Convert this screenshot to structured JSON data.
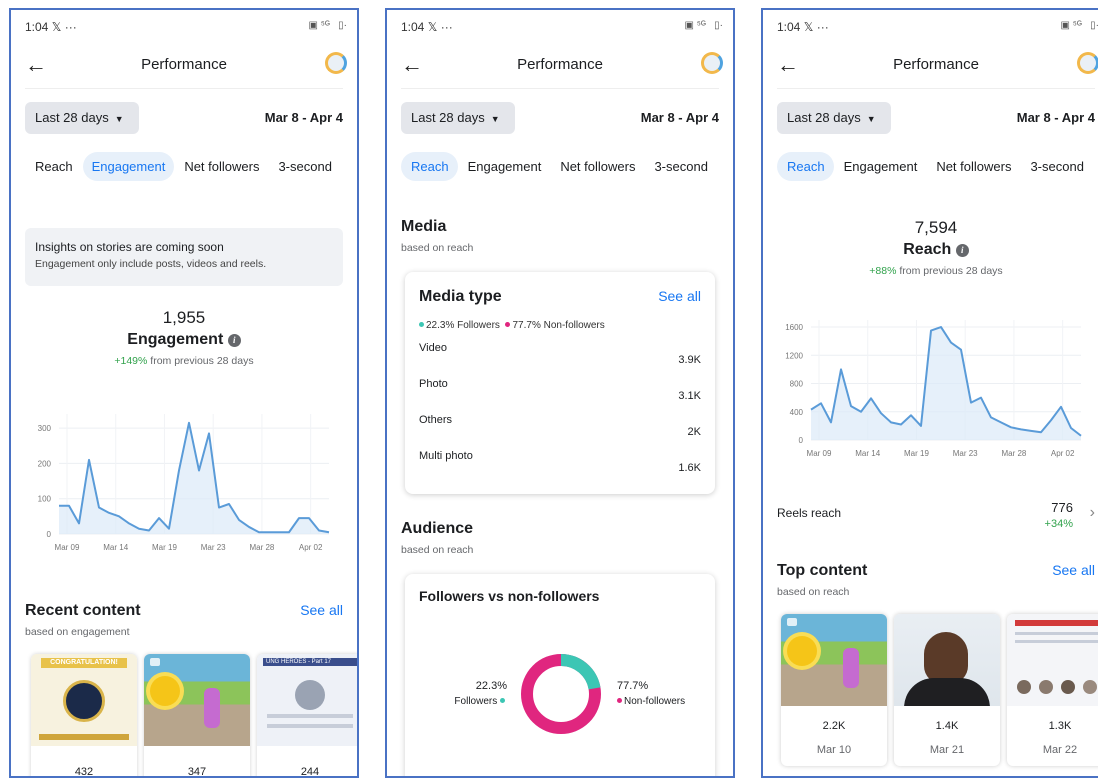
{
  "status": {
    "time": "1:04",
    "x": "𝕏",
    "dots": "···"
  },
  "header": {
    "title": "Performance"
  },
  "filter": {
    "range": "Last 28 days",
    "dates": "Mar 8 - Apr 4"
  },
  "tabs": [
    "Reach",
    "Engagement",
    "Net followers",
    "3-second"
  ],
  "screen1": {
    "notice_title": "Insights on stories are coming soon",
    "notice_text": "Engagement only include posts, videos and reels.",
    "total": "1,955",
    "metric": "Engagement",
    "change_pct": "+149%",
    "change_text": "from previous 28 days",
    "recent_title": "Recent content",
    "recent_sub": "based on engagement",
    "see_all": "See all",
    "thumb1_caption": "CONGRATULATION!",
    "thumb3_caption": "UNG HEROES - Part 17",
    "thumbs": [
      "432",
      "347",
      "244"
    ]
  },
  "screen2": {
    "media_title": "Media",
    "media_sub": "based on reach",
    "card_title": "Media type",
    "see_all": "See all",
    "legend_followers": "22.3% Followers",
    "legend_nonfollowers": "77.7% Non-followers",
    "media_rows": [
      {
        "label": "Video",
        "value": "3.9K",
        "followers": 0.223,
        "total": 3.9
      },
      {
        "label": "Photo",
        "value": "3.1K",
        "followers": 0.223,
        "total": 3.1
      },
      {
        "label": "Others",
        "value": "2K",
        "followers": 0.223,
        "total": 2.0
      },
      {
        "label": "Multi photo",
        "value": "1.6K",
        "followers": 0.223,
        "total": 1.6
      }
    ],
    "audience_title": "Audience",
    "audience_sub": "based on reach",
    "fvn_title": "Followers vs non-followers",
    "donut_left_pct": "22.3%",
    "donut_left_label": "Followers",
    "donut_right_pct": "77.7%",
    "donut_right_label": "Non-followers",
    "donut_followers_fraction": 0.223
  },
  "screen3": {
    "total": "7,594",
    "metric": "Reach",
    "change_pct": "+88%",
    "change_text": "from previous 28 days",
    "reels_label": "Reels reach",
    "reels_value": "776",
    "reels_change": "+34%",
    "top_title": "Top content",
    "top_sub": "based on reach",
    "see_all": "See all",
    "top_items": [
      {
        "value": "2.2K",
        "date": "Mar 10"
      },
      {
        "value": "1.4K",
        "date": "Mar 21"
      },
      {
        "value": "1.3K",
        "date": "Mar 22"
      }
    ]
  },
  "colors": {
    "accent": "#1877f2",
    "followers": "#3cc6b4",
    "nonfollowers": "#e0267f",
    "line": "#5a9bd8",
    "positive": "#31a24c"
  },
  "chart_data": [
    {
      "type": "area",
      "metric": "Engagement",
      "x_ticks": [
        "Mar 09",
        "Mar 14",
        "Mar 19",
        "Mar 23",
        "Mar 28",
        "Apr 02"
      ],
      "y_ticks": [
        0,
        100,
        200,
        300
      ],
      "ylim": [
        0,
        340
      ],
      "values": [
        80,
        80,
        30,
        210,
        75,
        60,
        50,
        30,
        15,
        10,
        45,
        15,
        180,
        315,
        180,
        285,
        75,
        85,
        40,
        20,
        5,
        5,
        5,
        5,
        45,
        45,
        10,
        5
      ]
    },
    {
      "type": "area",
      "metric": "Reach",
      "x_ticks": [
        "Mar 09",
        "Mar 14",
        "Mar 19",
        "Mar 23",
        "Mar 28",
        "Apr 02"
      ],
      "y_ticks": [
        0,
        400,
        800,
        1200,
        1600
      ],
      "ylim": [
        0,
        1700
      ],
      "values": [
        430,
        520,
        250,
        1000,
        480,
        400,
        590,
        380,
        250,
        220,
        350,
        200,
        1550,
        1600,
        1380,
        1280,
        530,
        600,
        320,
        250,
        180,
        150,
        130,
        110,
        280,
        470,
        170,
        60
      ]
    }
  ]
}
